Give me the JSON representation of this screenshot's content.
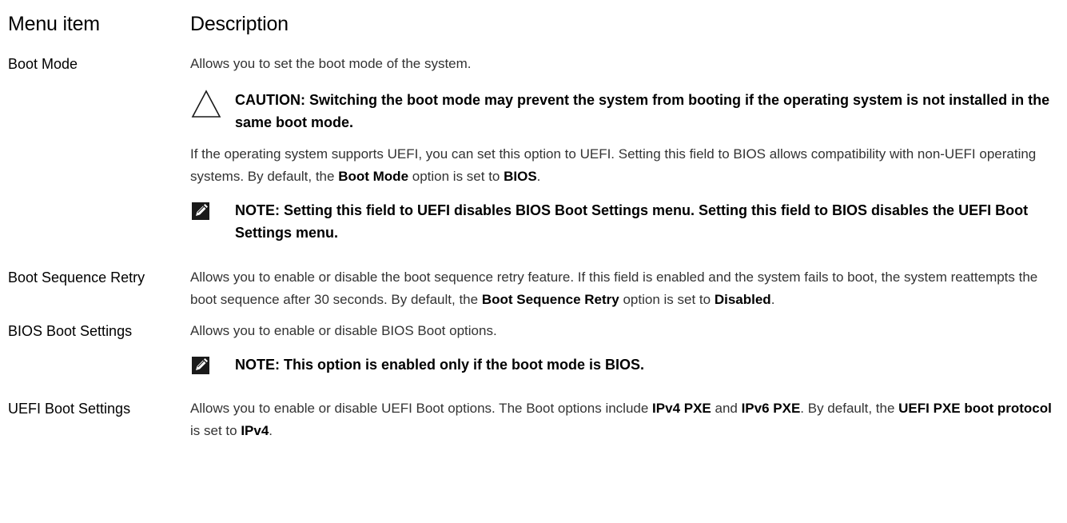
{
  "header": {
    "menu_item": "Menu item",
    "description": "Description"
  },
  "rows": [
    {
      "label": "Boot Mode",
      "intro": "Allows you to set the boot mode of the system.",
      "caution": "CAUTION: Switching the boot mode may prevent the system from booting if the operating system is not installed in the same boot mode.",
      "para_1": "If the operating system supports UEFI, you can set this option to UEFI. Setting this field to BIOS allows compatibility with non-UEFI operating systems. By default, the ",
      "para_bold_1": "Boot Mode",
      "para_2": " option is set to ",
      "para_bold_2": "BIOS",
      "para_3": ".",
      "note": "NOTE: Setting this field to UEFI disables BIOS Boot Settings menu. Setting this field to BIOS disables the UEFI Boot Settings menu."
    },
    {
      "label": "Boot Sequence Retry",
      "para_1": "Allows you to enable or disable the boot sequence retry feature. If this field is enabled and the system fails to boot, the system reattempts the boot sequence after 30 seconds. By default, the ",
      "para_bold_1": "Boot Sequence Retry",
      "para_2": " option is set to ",
      "para_bold_2": "Disabled",
      "para_3": "."
    },
    {
      "label": "BIOS Boot Settings",
      "intro": "Allows you to enable or disable BIOS Boot options.",
      "note": "NOTE: This option is enabled only if the boot mode is BIOS."
    },
    {
      "label": "UEFI Boot Settings",
      "para_1": "Allows you to enable or disable UEFI Boot options. The Boot options include ",
      "para_bold_1": "IPv4 PXE",
      "para_2": " and ",
      "para_bold_2": "IPv6 PXE",
      "para_3": ". By default, the ",
      "para_bold_3": "UEFI PXE boot protocol",
      "para_4": " is set to ",
      "para_bold_4": "IPv4",
      "para_5": "."
    }
  ],
  "icons": {
    "caution": "caution-triangle-icon",
    "note": "note-pencil-icon"
  }
}
